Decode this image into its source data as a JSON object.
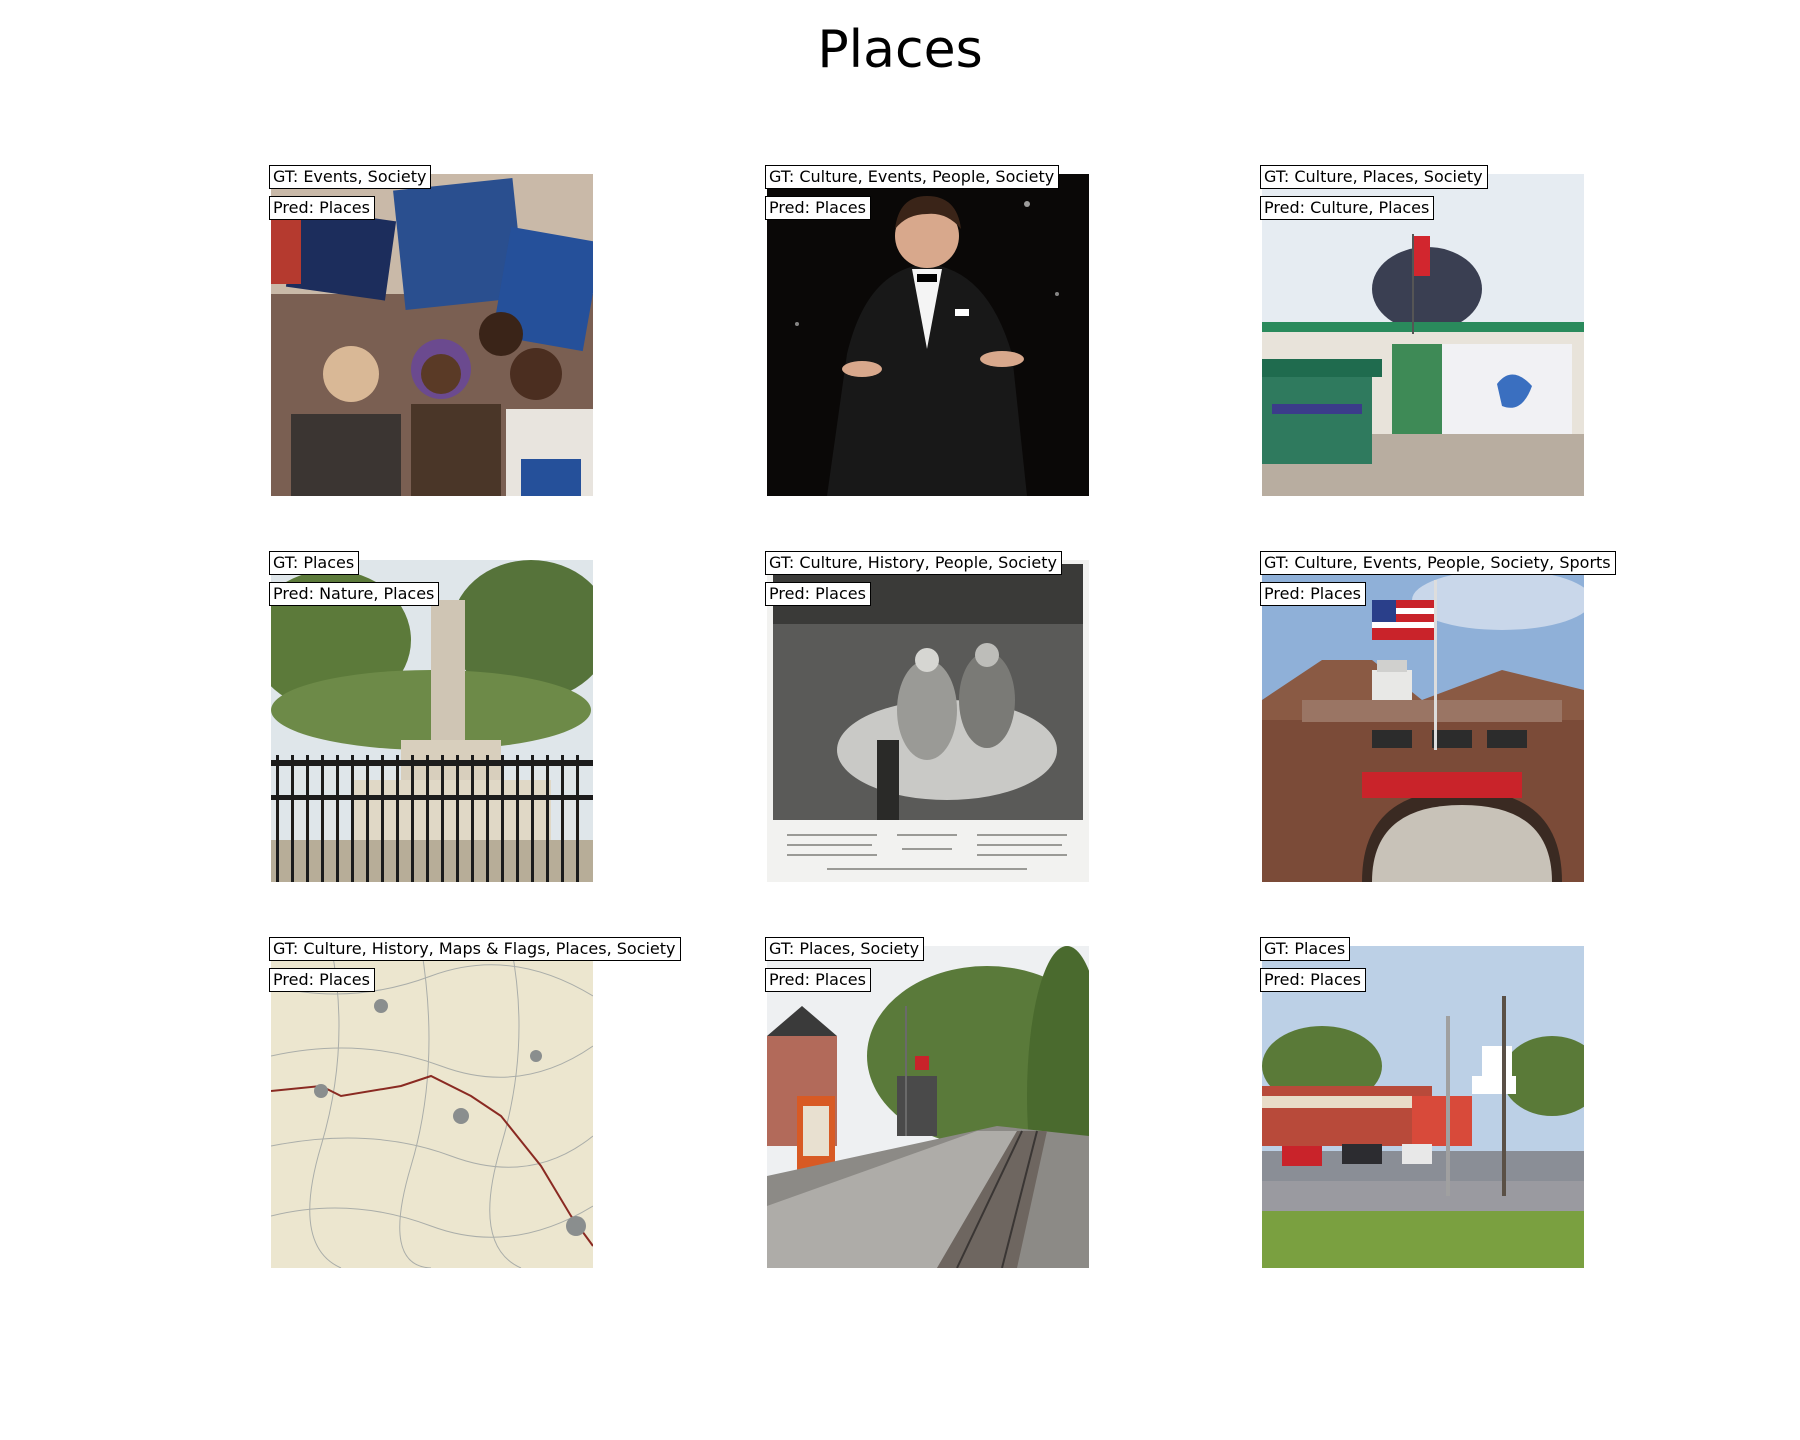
{
  "title": "Places",
  "panels": [
    {
      "gt": "GT: Events, Society",
      "pred": "Pred: Places",
      "image_subject": "political-rally-photo"
    },
    {
      "gt": "GT: Culture, Events, People, Society",
      "pred": "Pred: Places",
      "image_subject": "man-in-tuxedo-on-stage-photo"
    },
    {
      "gt": "GT: Culture, Places, Society",
      "pred": "Pred: Culture, Places",
      "image_subject": "shrine-building-photo"
    },
    {
      "gt": "GT: Places",
      "pred": "Pred: Nature, Places",
      "image_subject": "monument-behind-iron-fence-photo"
    },
    {
      "gt": "GT: Culture, History, People, Society",
      "pred": "Pred: Places",
      "image_subject": "engraving-deathbed-scene"
    },
    {
      "gt": "GT: Culture, Events, People, Society, Sports",
      "pred": "Pred: Places",
      "image_subject": "brick-building-with-flag-photo"
    },
    {
      "gt": "GT: Culture, History, Maps & Flags, Places, Society",
      "pred": "Pred: Places",
      "image_subject": "old-map-image"
    },
    {
      "gt": "GT: Places, Society",
      "pred": "Pred: Places",
      "image_subject": "railway-platform-photo"
    },
    {
      "gt": "GT: Places",
      "pred": "Pred: Places",
      "image_subject": "street-intersection-photo"
    }
  ]
}
